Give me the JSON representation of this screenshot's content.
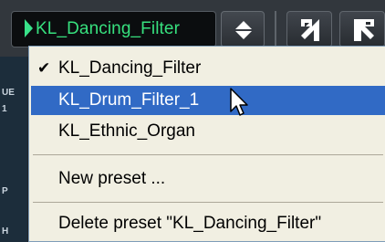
{
  "toolbar": {
    "preset_name": "KL_Dancing_Filter"
  },
  "side_labels": [
    "UE",
    "1",
    "P",
    "H"
  ],
  "menu": {
    "items": [
      {
        "label": "KL_Dancing_Filter",
        "checked": true,
        "selected": false
      },
      {
        "label": "KL_Drum_Filter_1",
        "checked": false,
        "selected": true
      },
      {
        "label": "KL_Ethnic_Organ",
        "checked": false,
        "selected": false
      }
    ],
    "new_preset": "New preset ...",
    "delete_preset": "Delete preset \"KL_Dancing_Filter\""
  },
  "colors": {
    "accent_green": "#37e07e",
    "selection_blue": "#316ac5",
    "menu_bg": "#f1efe2"
  }
}
